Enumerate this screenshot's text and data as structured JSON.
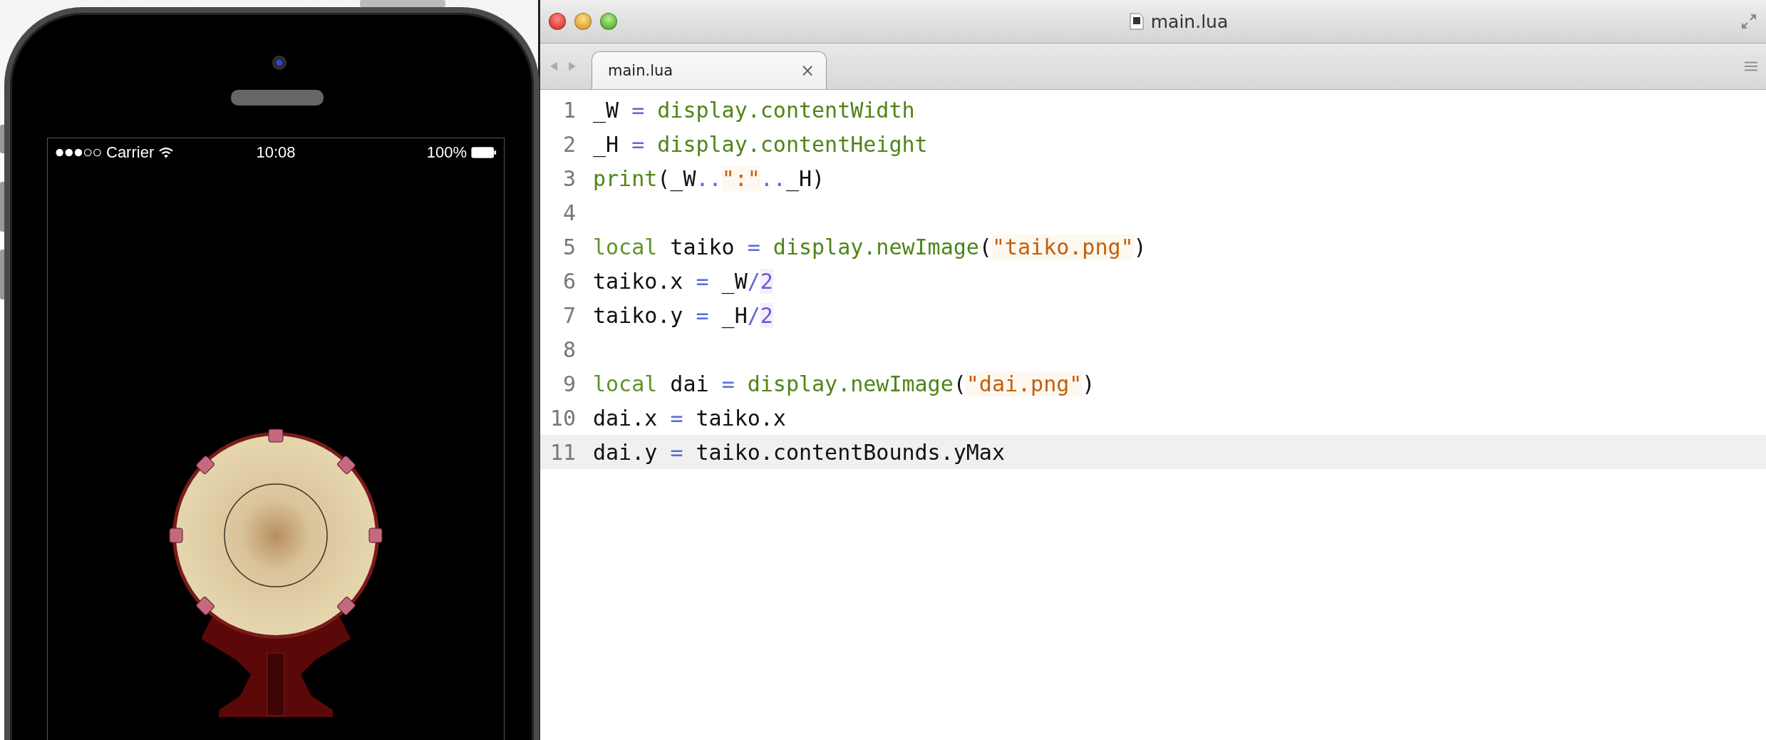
{
  "phone": {
    "status_bar": {
      "carrier": "Carrier",
      "time": "10:08",
      "battery": "100%"
    }
  },
  "editor": {
    "window": {
      "title": "main.lua"
    },
    "tabs": [
      {
        "label": "main.lua",
        "close": "×",
        "selected": true
      }
    ],
    "lines": [
      {
        "number": "1",
        "current": false,
        "tokens": [
          {
            "kind": "plain",
            "text": "_W "
          },
          {
            "kind": "op",
            "text": "="
          },
          {
            "kind": "fn",
            "text": " display.contentWidth"
          }
        ]
      },
      {
        "number": "2",
        "current": false,
        "tokens": [
          {
            "kind": "plain",
            "text": "_H "
          },
          {
            "kind": "op",
            "text": "="
          },
          {
            "kind": "fn",
            "text": " display.contentHeight"
          }
        ]
      },
      {
        "number": "3",
        "current": false,
        "tokens": [
          {
            "kind": "fn",
            "text": "print"
          },
          {
            "kind": "plain",
            "text": "(_W"
          },
          {
            "kind": "op",
            "text": ".."
          },
          {
            "kind": "str",
            "text": "\":\""
          },
          {
            "kind": "op",
            "text": ".."
          },
          {
            "kind": "plain",
            "text": "_H)"
          }
        ]
      },
      {
        "number": "4",
        "current": false
      },
      {
        "number": "5",
        "current": false,
        "tokens": [
          {
            "kind": "kw",
            "text": "local"
          },
          {
            "kind": "plain",
            "text": " taiko "
          },
          {
            "kind": "op",
            "text": "="
          },
          {
            "kind": "fn",
            "text": " display.newImage"
          },
          {
            "kind": "plain",
            "text": "("
          },
          {
            "kind": "str",
            "text": "\"taiko.png\""
          },
          {
            "kind": "plain",
            "text": ")"
          }
        ]
      },
      {
        "number": "6",
        "current": false,
        "tokens": [
          {
            "kind": "plain",
            "text": "taiko.x "
          },
          {
            "kind": "op",
            "text": "="
          },
          {
            "kind": "plain",
            "text": " _W"
          },
          {
            "kind": "op",
            "text": "/"
          },
          {
            "kind": "num",
            "text": "2"
          }
        ]
      },
      {
        "number": "7",
        "current": false,
        "tokens": [
          {
            "kind": "plain",
            "text": "taiko.y "
          },
          {
            "kind": "op",
            "text": "="
          },
          {
            "kind": "plain",
            "text": " _H"
          },
          {
            "kind": "op",
            "text": "/"
          },
          {
            "kind": "num",
            "text": "2"
          }
        ]
      },
      {
        "number": "8",
        "current": false
      },
      {
        "number": "9",
        "current": false,
        "tokens": [
          {
            "kind": "kw",
            "text": "local"
          },
          {
            "kind": "plain",
            "text": " dai "
          },
          {
            "kind": "op",
            "text": "="
          },
          {
            "kind": "fn",
            "text": " display.newImage"
          },
          {
            "kind": "plain",
            "text": "("
          },
          {
            "kind": "str",
            "text": "\"dai.png\""
          },
          {
            "kind": "plain",
            "text": ")"
          }
        ]
      },
      {
        "number": "10",
        "current": false,
        "tokens": [
          {
            "kind": "plain",
            "text": "dai.x "
          },
          {
            "kind": "op",
            "text": "="
          },
          {
            "kind": "plain",
            "text": " taiko.x"
          }
        ]
      },
      {
        "number": "11",
        "current": true,
        "tokens": [
          {
            "kind": "plain",
            "text": "dai.y "
          },
          {
            "kind": "op",
            "text": "="
          },
          {
            "kind": "plain",
            "text": " taiko.contentBounds.yMax"
          }
        ]
      }
    ]
  }
}
